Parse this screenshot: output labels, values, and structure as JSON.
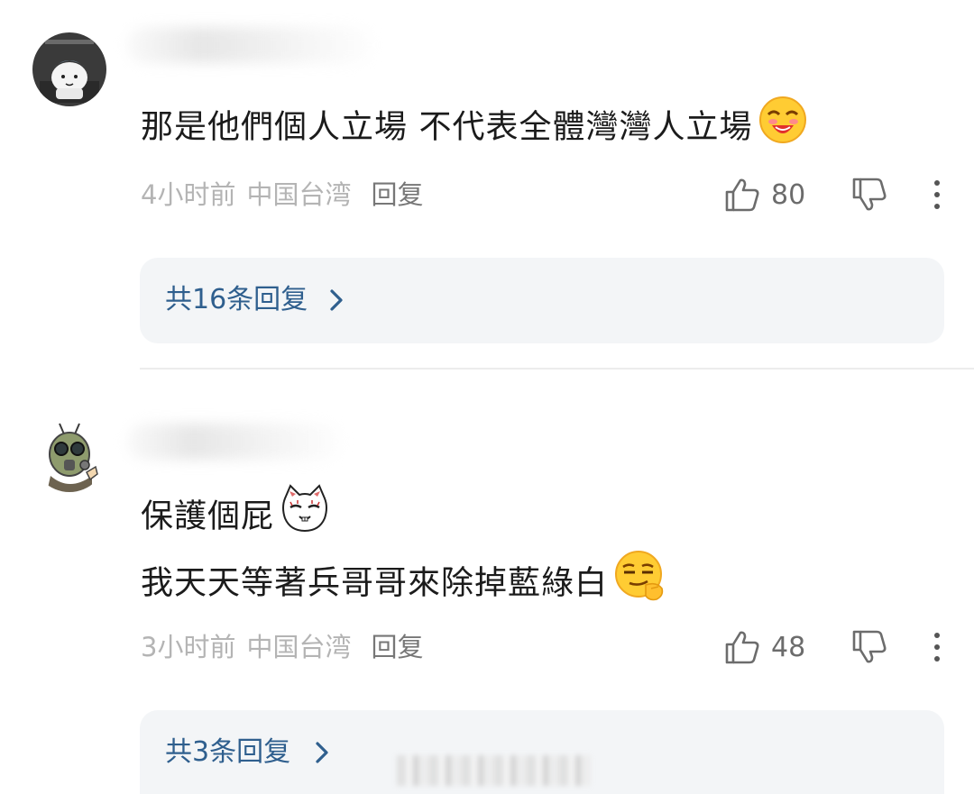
{
  "comments": [
    {
      "lines": [
        "那是他們個人立場 不代表全體灣灣人立場"
      ],
      "time": "4小时前",
      "region": "中国台湾",
      "reply_label": "回复",
      "likes": "80",
      "replies_label": "共16条回复"
    },
    {
      "lines": [
        "保護個屁",
        "我天天等著兵哥哥來除掉藍綠白"
      ],
      "time": "3小时前",
      "region": "中国台湾",
      "reply_label": "回复",
      "likes": "48",
      "replies_label": "共3条回复"
    }
  ],
  "icons": {
    "like": "thumbs-up-icon",
    "dislike": "thumbs-down-icon",
    "more": "more-vertical-icon",
    "chevron": "chevron-right-icon"
  },
  "colors": {
    "body_text": "#1b1b1b",
    "meta_text": "#b4b4b4",
    "reply_text": "#777777",
    "link_blue": "#2f5f8e",
    "replies_bg": "#f3f5f7"
  }
}
